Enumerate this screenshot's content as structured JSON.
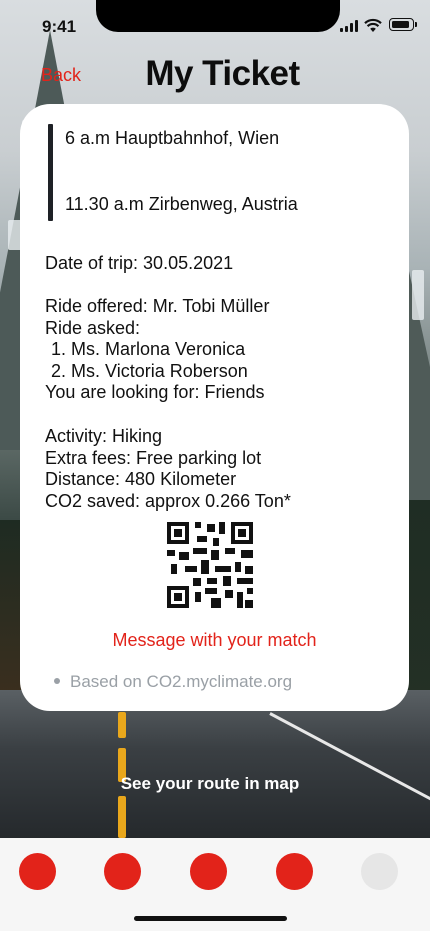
{
  "status_bar": {
    "time": "9:41"
  },
  "header": {
    "back_label": "Back",
    "title": "My Ticket"
  },
  "ticket": {
    "departure": "6 a.m Hauptbahnhof, Wien",
    "arrival": "11.30 a.m Zirbenweg, Austria",
    "date": "Date of trip: 30.05.2021",
    "ride_offered": "Ride offered: Mr. Tobi Müller",
    "ride_asked_label": "Ride asked:",
    "passengers": [
      "1. Ms. Marlona Veronica",
      "2. Ms. Victoria Roberson"
    ],
    "looking_for": "You are looking for: Friends",
    "activity": "Activity: Hiking",
    "extra_fees": "Extra fees: Free parking lot",
    "distance": "Distance: 480 Kilometer",
    "co2": "CO2 saved: approx 0.266 Ton*",
    "message_link": "Message with your match",
    "footnote": "Based on CO2.myclimate.org"
  },
  "route_link": "See your route in map",
  "tabbar": {
    "tabs": [
      {
        "name": "tab-1",
        "color": "#e2231a"
      },
      {
        "name": "tab-2",
        "color": "#e2231a"
      },
      {
        "name": "tab-3",
        "color": "#e2231a"
      },
      {
        "name": "tab-4",
        "color": "#e2231a"
      },
      {
        "name": "tab-5",
        "color": "#e6e6e6"
      }
    ]
  },
  "colors": {
    "accent": "#e2231a",
    "text": "#111111",
    "muted": "#9aa0a6"
  }
}
